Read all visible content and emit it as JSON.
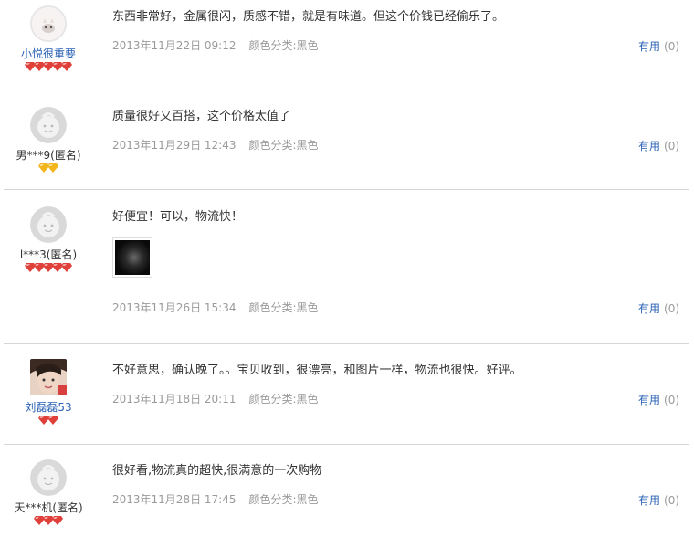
{
  "reviews": [
    {
      "user": "小悦很重要",
      "content": "东西非常好，金属很闪，质感不错，就是有味道。但这个价钱已经偷乐了。",
      "date": "2013年11月22日 09:12",
      "sku": "颜色分类:黑色",
      "useful_label": "有用",
      "useful_count": "(0)",
      "level": {
        "gem_color": "#e0403a",
        "gem_count": 5
      }
    },
    {
      "user": "男***9(匿名)",
      "content": "质量很好又百搭，这个价格太值了",
      "date": "2013年11月29日 12:43",
      "sku": "颜色分类:黑色",
      "useful_label": "有用",
      "useful_count": "(0)",
      "level": {
        "gem_color": "#f2b51c",
        "gem_count": 2
      }
    },
    {
      "user": "l***3(匿名)",
      "content": "好便宜！可以，物流快！",
      "date": "2013年11月26日 15:34",
      "sku": "颜色分类:黑色",
      "useful_label": "有用",
      "useful_count": "(0)",
      "has_photo": true,
      "level": {
        "gem_color": "#e0403a",
        "gem_count": 5
      }
    },
    {
      "user": "刘磊磊53",
      "content": "不好意思，确认晚了。。宝贝收到，很漂亮，和图片一样，物流也很快。好评。",
      "date": "2013年11月18日 20:11",
      "sku": "颜色分类:黑色",
      "useful_label": "有用",
      "useful_count": "(0)",
      "level": {
        "gem_color": "#e0403a",
        "gem_count": 2
      }
    },
    {
      "user": "天***机(匿名)",
      "content": "很好看,物流真的超快,很满意的一次购物",
      "date": "2013年11月28日 17:45",
      "sku": "颜色分类:黑色",
      "useful_label": "有用",
      "useful_count": "(0)",
      "level": {
        "gem_color": "#e0403a",
        "gem_count": 3
      }
    }
  ],
  "colors": {
    "link": "#2a62b4",
    "meta": "#9a9a9a",
    "divider": "#d6d6d6"
  }
}
